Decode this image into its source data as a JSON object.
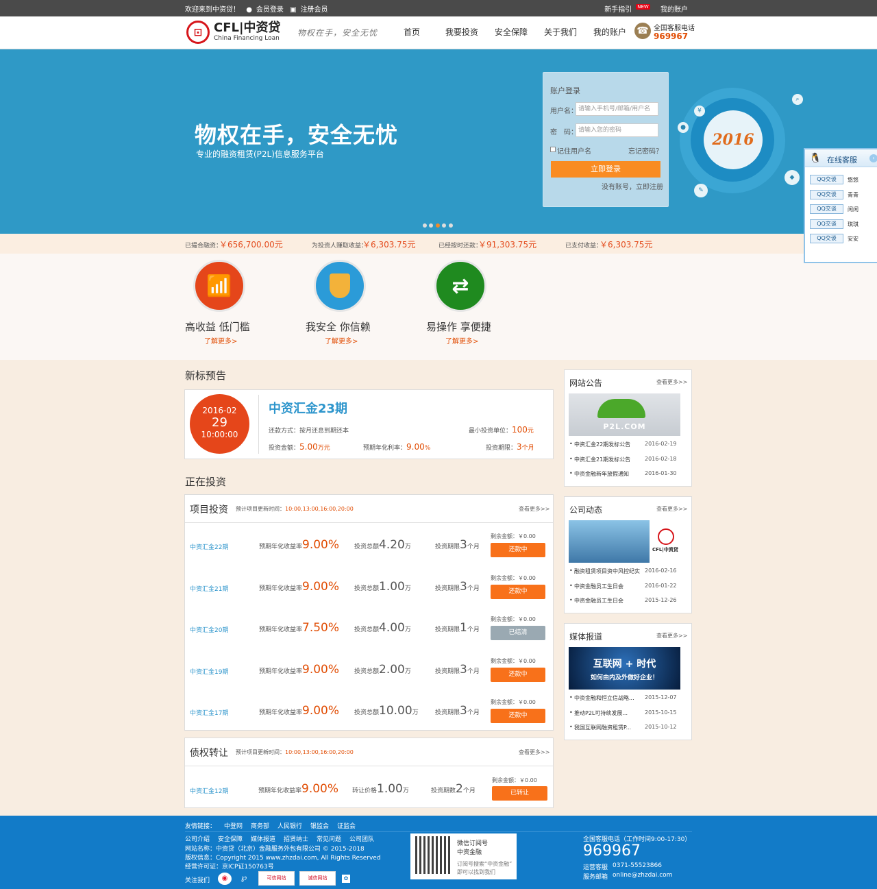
{
  "topbar": {
    "welcome": "欢迎来到中资贷！",
    "login": "会员登录",
    "register": "注册会员",
    "guide": "新手指引",
    "new_tag": "NEW",
    "account": "我的账户"
  },
  "header": {
    "logo_mark": "⊡",
    "logo_text": "CFL|中资贷",
    "logo_sub": "China Financing Loan",
    "slogan": "物权在手，安全无忧",
    "nav": [
      "首页",
      "我要投资",
      "安全保障",
      "关于我们",
      "我的账户"
    ],
    "tel_label": "全国客服电话",
    "tel_number": "969967"
  },
  "banner": {
    "title": "物权在手，安全无忧",
    "subtitle": "专业的融资租赁(P2L)信息服务平台",
    "year": "2016",
    "login": {
      "title": "账户登录",
      "user_label": "用户名：",
      "user_placeholder": "请输入手机号/邮箱/用户名",
      "pwd_label": "密　码：",
      "pwd_placeholder": "请输入您的密码",
      "remember": "记住用户名",
      "forgot": "忘记密码？",
      "submit": "立即登录",
      "no_account": "没有账号，立即注册"
    }
  },
  "stats": [
    {
      "label": "已撮合融资：",
      "value": "￥656,700.00元"
    },
    {
      "label": "为投资人赚取收益：",
      "value": "￥6,303.75元"
    },
    {
      "label": "已经按时还款：",
      "value": "￥91,303.75元"
    },
    {
      "label": "已支付收益：",
      "value": "￥6,303.75元"
    }
  ],
  "features": [
    {
      "title": "高收益 低门槛",
      "more": "了解更多>",
      "color": "#e5461a",
      "icon": "chart-icon"
    },
    {
      "title": "我安全 你信赖",
      "more": "了解更多>",
      "color": "#2b9bd8",
      "icon": "shield-icon"
    },
    {
      "title": "易操作 享便捷",
      "more": "了解更多>",
      "color": "#1f8a1f",
      "icon": "refresh-icon"
    }
  ],
  "preview": {
    "section": "新标预告",
    "date": "2016-02",
    "day": "29",
    "time": "10:00:00",
    "name": "中资汇金23期",
    "repay_label": "还款方式：",
    "repay": "按月还息到期还本",
    "min_label": "最小投资单位：",
    "min_value": "100",
    "min_unit": "元",
    "amount_label": "投资金额：",
    "amount": "5.00",
    "amount_unit": "万元",
    "rate_label": "预期年化利率：",
    "rate": "9.00",
    "rate_unit": "%",
    "period_label": "投资期限：",
    "period": "3",
    "period_unit": "个月"
  },
  "investing": {
    "section": "正在投资",
    "box_title": "项目投资",
    "update_label": "预计项目更新时间：",
    "update_times": "10:00,13:00,16:00,20:00",
    "more": "查看更多>>",
    "rate_label": "预期年化收益率",
    "amount_label": "投资总额",
    "period_label": "投资期限",
    "remain_label": "剩余金额：￥0.00",
    "rows": [
      {
        "name": "中资汇金22期",
        "rate": "9.00%",
        "amount": "4.20",
        "amount_unit": "万",
        "period": "3",
        "period_unit": "个月",
        "status": "还款中",
        "done": false
      },
      {
        "name": "中资汇金21期",
        "rate": "9.00%",
        "amount": "1.00",
        "amount_unit": "万",
        "period": "3",
        "period_unit": "个月",
        "status": "还款中",
        "done": false
      },
      {
        "name": "中资汇金20期",
        "rate": "7.50%",
        "amount": "4.00",
        "amount_unit": "万",
        "period": "1",
        "period_unit": "个月",
        "status": "已结清",
        "done": true
      },
      {
        "name": "中资汇金19期",
        "rate": "9.00%",
        "amount": "2.00",
        "amount_unit": "万",
        "period": "3",
        "period_unit": "个月",
        "status": "还款中",
        "done": false
      },
      {
        "name": "中资汇金17期",
        "rate": "9.00%",
        "amount": "10.00",
        "amount_unit": "万",
        "period": "3",
        "period_unit": "个月",
        "status": "还款中",
        "done": false
      }
    ]
  },
  "transfer": {
    "box_title": "债权转让",
    "update_label": "预计项目更新时间：",
    "update_times": "10:00,13:00,16:00,20:00",
    "more": "查看更多>>",
    "row": {
      "name": "中资汇金12期",
      "rate_label": "预期年化收益率",
      "rate": "9.00%",
      "price_label": "转让价格",
      "price": "1.00",
      "price_unit": "万",
      "period_label": "投资期数",
      "period": "2",
      "period_unit": "个月",
      "remain": "剩余金额：￥0.00",
      "status": "已转让"
    }
  },
  "sidebar": {
    "notice": {
      "title": "网站公告",
      "more": "查看更多>>",
      "image_text": "P2L.COM",
      "items": [
        {
          "t": "中资汇金22期发标公告",
          "d": "2016-02-19"
        },
        {
          "t": "中资汇金21期发标公告",
          "d": "2016-02-18"
        },
        {
          "t": "中资金融新年放假通知",
          "d": "2016-01-30"
        }
      ]
    },
    "company": {
      "title": "公司动态",
      "more": "查看更多>>",
      "image_text": "CFL|中资贷",
      "items": [
        {
          "t": "融资租赁项目资中风控纪实",
          "d": "2016-02-16"
        },
        {
          "t": "中资金融员工生日会",
          "d": "2016-01-22"
        },
        {
          "t": "中资金融员工生日会",
          "d": "2015-12-26"
        }
      ]
    },
    "media": {
      "title": "媒体报道",
      "more": "查看更多>>",
      "image_line1": "互联网 + 时代",
      "image_line2": "如何由内及外做好企业！",
      "items": [
        {
          "t": "中资金融和恒立信战略...",
          "d": "2015-12-07"
        },
        {
          "t": "推动P2L可持续发展...",
          "d": "2015-10-15"
        },
        {
          "t": "我国互联网融资租赁P...",
          "d": "2015-10-12"
        }
      ]
    }
  },
  "qq_widget": {
    "title": "在线客服",
    "button": "QQ交谈",
    "agents": [
      "悠悠",
      "青青",
      "闲闲",
      "琪琪",
      "安安"
    ]
  },
  "footer": {
    "links_label": "友情链接：",
    "links": [
      "中登网",
      "商务部",
      "人民银行",
      "银监会",
      "证监会"
    ],
    "nav": [
      "公司介绍",
      "安全保障",
      "媒体报道",
      "招贤纳士",
      "常见问题",
      "公司团队"
    ],
    "site": "网站名称：中资贷（北京）金融服务外包有限公司 © 2015-2018",
    "copyright": "版权信息：Copyright 2015 www.zhzdai.com, All Rights Reserved",
    "license": "经营许可证：京ICP证150763号",
    "follow": "关注我们",
    "badges": [
      "可信网站",
      "诚信网站"
    ],
    "wechat_title": "微信订阅号",
    "wechat_name": "中资金融",
    "wechat_tip1": "订阅号搜索“中资金融”",
    "wechat_tip2": "即可以找到我们",
    "service_label": "全国客服电话（工作时间9:00-17:30）",
    "service_number": "969967",
    "ops_label": "运营客服",
    "ops_value": "0371-55523866",
    "mail_label": "服务邮箱",
    "mail_value": "online@zhzdai.com"
  }
}
